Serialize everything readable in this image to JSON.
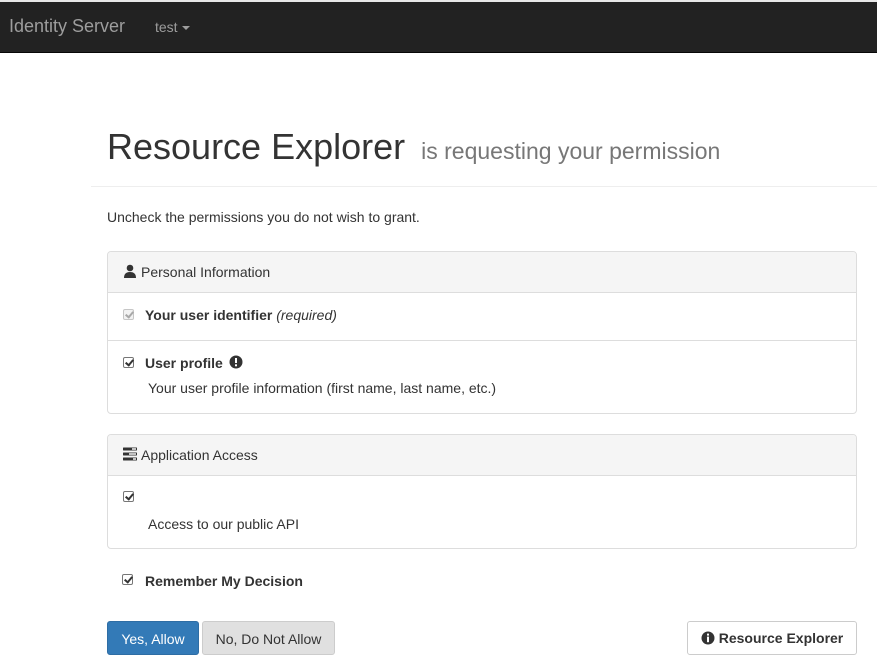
{
  "navbar": {
    "brand": "Identity Server",
    "user_menu_label": "test"
  },
  "header": {
    "client_name": "Resource Explorer",
    "subtitle": "is requesting your permission"
  },
  "instruction": "Uncheck the permissions you do not wish to grant.",
  "identity_scopes": {
    "heading": "Personal Information",
    "icon": "user-icon",
    "items": [
      {
        "label": "Your user identifier",
        "required_text": "(required)",
        "checked": true,
        "disabled": true
      },
      {
        "label": "User profile",
        "emphasize_icon": "exclamation-circle-icon",
        "description": "Your user profile information (first name, last name, etc.)",
        "checked": true
      }
    ]
  },
  "resource_scopes": {
    "heading": "Application Access",
    "icon": "tasks-icon",
    "items": [
      {
        "label": "",
        "description": "Access to our public API",
        "checked": true
      }
    ]
  },
  "remember": {
    "label": "Remember My Decision",
    "checked": true
  },
  "buttons": {
    "allow": "Yes, Allow",
    "deny": "No, Do Not Allow",
    "client_link": "Resource Explorer",
    "client_link_icon": "info-circle-icon"
  },
  "colors": {
    "navbar_bg": "#222222",
    "navbar_text": "#9d9d9d",
    "primary": "#337ab7",
    "panel_heading_bg": "#f5f5f5",
    "border": "#dddddd"
  }
}
